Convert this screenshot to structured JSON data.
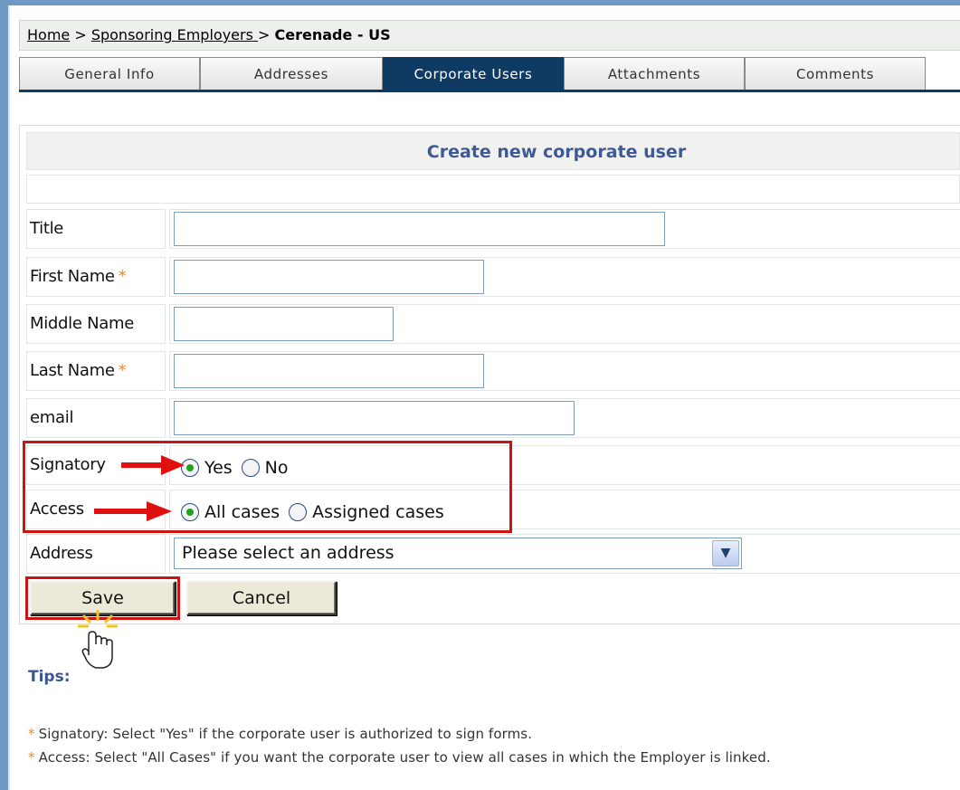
{
  "breadcrumb": {
    "home": "Home",
    "sep1": " > ",
    "employers": "Sponsoring Employers ",
    "sep2": "> ",
    "current": "Cerenade - US"
  },
  "tabs": [
    {
      "label": "General Info",
      "active": false
    },
    {
      "label": "Addresses",
      "active": false
    },
    {
      "label": "Corporate Users",
      "active": true
    },
    {
      "label": "Attachments",
      "active": false
    },
    {
      "label": "Comments",
      "active": false
    }
  ],
  "form": {
    "title": "Create new corporate user",
    "fields": {
      "title": {
        "label": "Title",
        "value": ""
      },
      "first_name": {
        "label": "First Name",
        "required_mark": "*",
        "value": ""
      },
      "middle_name": {
        "label": "Middle Name",
        "value": ""
      },
      "last_name": {
        "label": "Last Name",
        "required_mark": "*",
        "value": ""
      },
      "email": {
        "label": "email",
        "value": ""
      }
    },
    "signatory": {
      "label": "Signatory",
      "options": [
        "Yes",
        "No"
      ],
      "selected": "Yes"
    },
    "access": {
      "label": "Access",
      "options": [
        "All cases",
        "Assigned cases"
      ],
      "selected": "All cases"
    },
    "address": {
      "label": "Address",
      "selected": "Please select an address"
    },
    "save_label": "Save",
    "cancel_label": "Cancel"
  },
  "tips": {
    "title": "Tips:",
    "items": [
      {
        "star": "*",
        "text": "Signatory: Select \"Yes\" if the corporate user is authorized to sign forms."
      },
      {
        "star": "*",
        "text": "Access: Select \"All Cases\" if you want the corporate user to view all cases in which the Employer is linked."
      }
    ]
  },
  "colors": {
    "active_tab": "#0f3a64",
    "highlight": "#cc1414",
    "required": "#f08a1a",
    "title_text": "#3d5a96"
  }
}
